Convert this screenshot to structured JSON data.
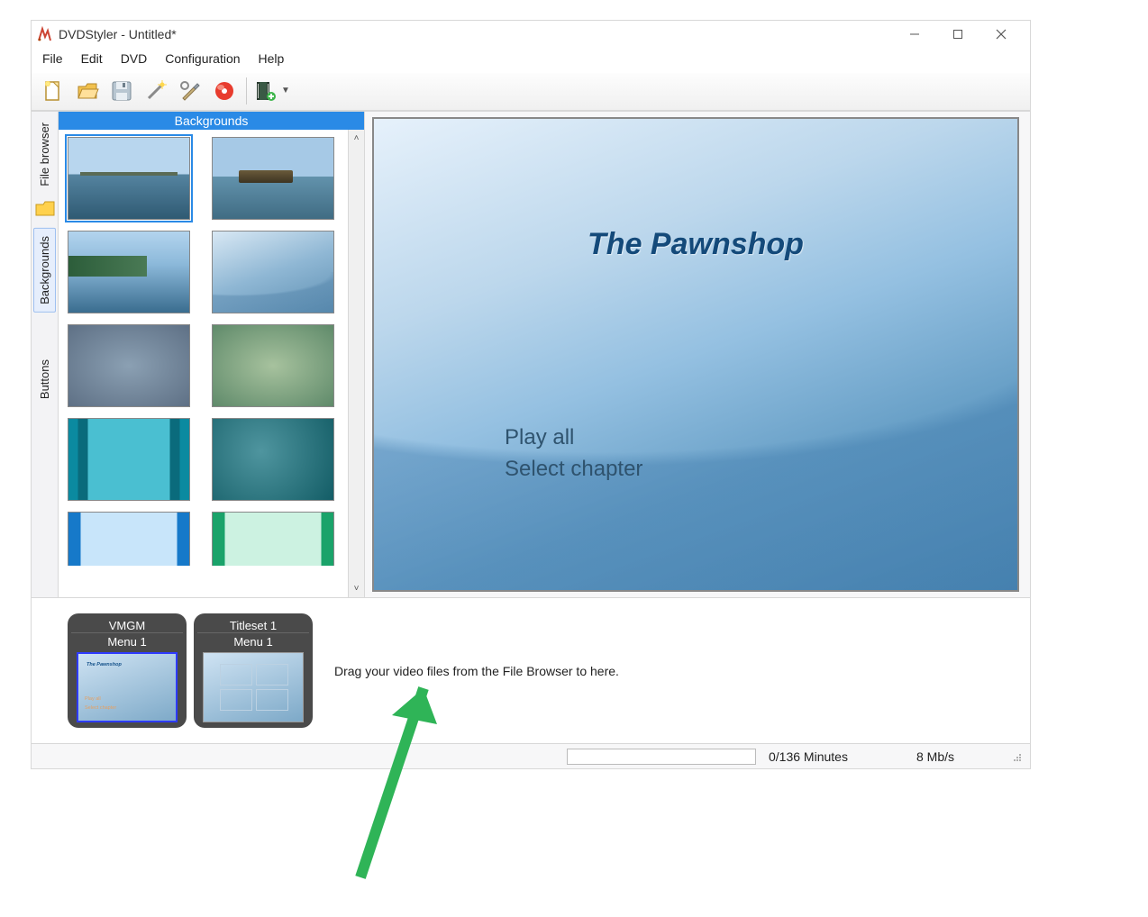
{
  "window": {
    "title": "DVDStyler - Untitled*"
  },
  "menu": {
    "file": "File",
    "edit": "Edit",
    "dvd": "DVD",
    "config": "Configuration",
    "help": "Help"
  },
  "panel": {
    "header": "Backgrounds"
  },
  "side_tabs": {
    "file_browser": "File browser",
    "backgrounds": "Backgrounds",
    "buttons": "Buttons"
  },
  "preview": {
    "title": "The Pawnshop",
    "option_play_all": "Play all",
    "option_select_chapter": "Select chapter"
  },
  "timeline": {
    "card1": {
      "name": "VMGM",
      "menu": "Menu 1"
    },
    "card2": {
      "name": "Titleset 1",
      "menu": "Menu 1"
    },
    "hint": "Drag your video files from the File Browser to here."
  },
  "status": {
    "minutes": "0/136 Minutes",
    "bitrate": "8 Mb/s"
  }
}
